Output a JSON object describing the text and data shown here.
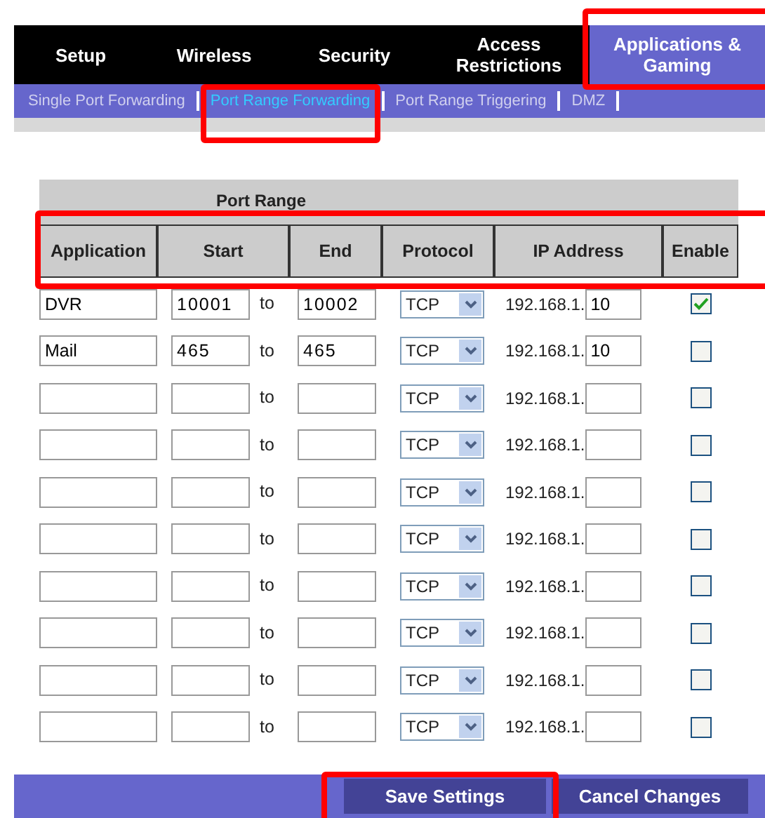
{
  "tabs": [
    {
      "label": "Setup",
      "selected": false
    },
    {
      "label": "Wireless",
      "selected": false
    },
    {
      "label": "Security",
      "selected": false
    },
    {
      "label": "Access Restrictions",
      "selected": false
    },
    {
      "label": "Applications & Gaming",
      "selected": true
    }
  ],
  "subtabs": [
    {
      "label": "Single Port Forwarding",
      "selected": false
    },
    {
      "label": "Port Range Forwarding",
      "selected": true
    },
    {
      "label": "Port Range Triggering",
      "selected": false
    },
    {
      "label": "DMZ",
      "selected": false
    }
  ],
  "table": {
    "group_heading": "Port Range",
    "columns": [
      "Application",
      "Start",
      "End",
      "Protocol",
      "IP Address",
      "Enable"
    ],
    "rows": [
      {
        "application": "DVR",
        "start": "10001",
        "to": "to",
        "end": "10002",
        "protocol": "TCP",
        "ip_prefix": "192.168.1.",
        "ip_suffix": "10",
        "enabled": true
      },
      {
        "application": "Mail",
        "start": "465",
        "to": "to",
        "end": "465",
        "protocol": "TCP",
        "ip_prefix": "192.168.1.",
        "ip_suffix": "10",
        "enabled": false
      },
      {
        "to": "to",
        "protocol": "TCP",
        "ip_prefix": "192.168.1.",
        "enabled": false
      },
      {
        "to": "to",
        "protocol": "TCP",
        "ip_prefix": "192.168.1.",
        "enabled": false
      },
      {
        "to": "to",
        "protocol": "TCP",
        "ip_prefix": "192.168.1.",
        "enabled": false
      },
      {
        "to": "to",
        "protocol": "TCP",
        "ip_prefix": "192.168.1.",
        "enabled": false
      },
      {
        "to": "to",
        "protocol": "TCP",
        "ip_prefix": "192.168.1.",
        "enabled": false
      },
      {
        "to": "to",
        "protocol": "TCP",
        "ip_prefix": "192.168.1.",
        "enabled": false
      },
      {
        "to": "to",
        "protocol": "TCP",
        "ip_prefix": "192.168.1.",
        "enabled": false
      },
      {
        "to": "to",
        "protocol": "TCP",
        "ip_prefix": "192.168.1.",
        "enabled": false
      }
    ]
  },
  "buttons": [
    "Save Settings",
    "Cancel Changes"
  ]
}
